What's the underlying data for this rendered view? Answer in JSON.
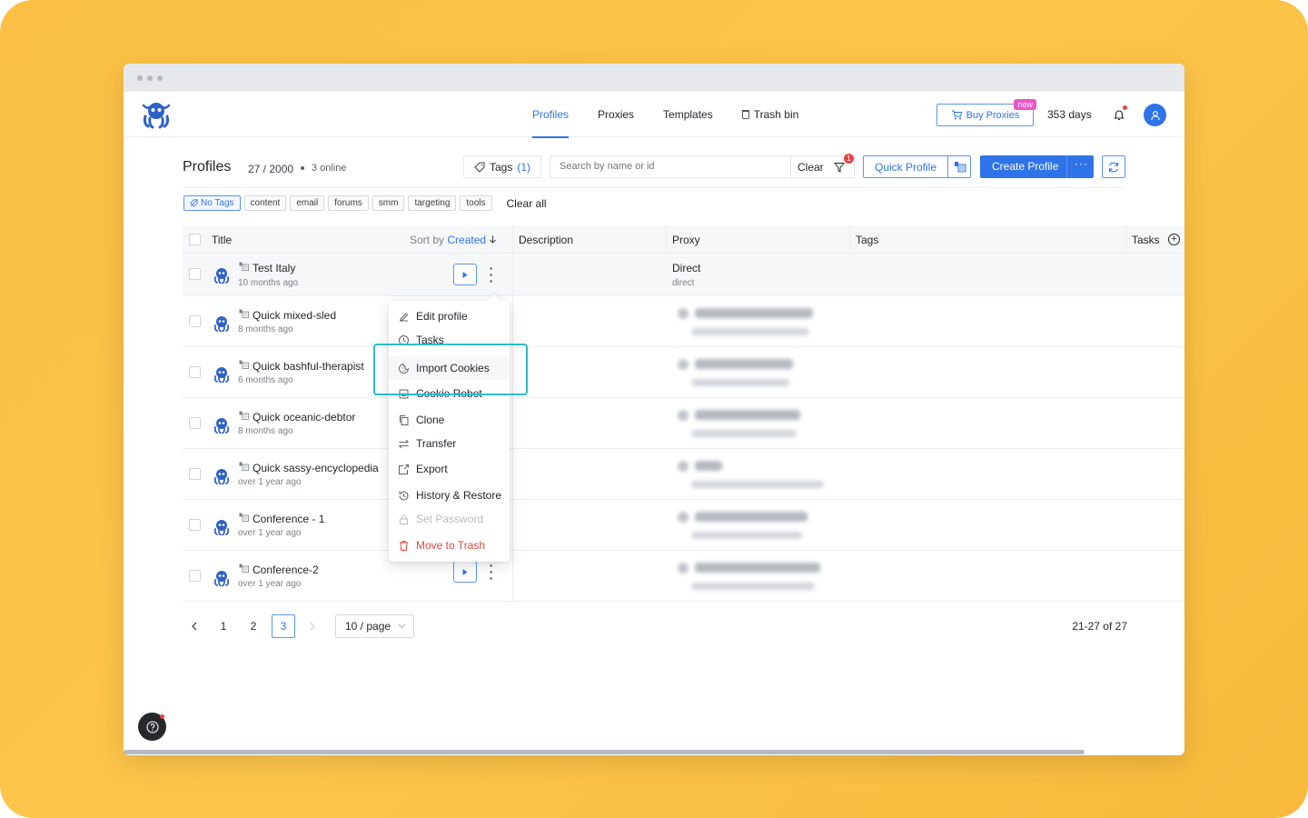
{
  "nav": {
    "tabs": [
      "Profiles",
      "Proxies",
      "Templates",
      "Trash bin"
    ],
    "buy_proxies": "Buy Proxies",
    "new_badge": "new",
    "days": "353 days"
  },
  "header": {
    "title": "Profiles",
    "count": "27 / 2000",
    "online": "3 online",
    "tags_label": "Tags",
    "tags_count": "(1)",
    "search_placeholder": "Search by name or id",
    "clear": "Clear",
    "filter_badge": "1",
    "quick_profile": "Quick Profile",
    "create_profile": "Create Profile",
    "create_more": "···"
  },
  "tag_filters": {
    "chips": [
      "No Tags",
      "content",
      "email",
      "forums",
      "smm",
      "targeting",
      "tools"
    ],
    "clear_all": "Clear all"
  },
  "table": {
    "columns": {
      "title": "Title",
      "sort_by": "Sort by",
      "sort_value": "Created",
      "description": "Description",
      "proxy": "Proxy",
      "tags": "Tags",
      "tasks": "Tasks"
    },
    "rows": [
      {
        "name": "Test Italy",
        "time": "10 months ago",
        "proxy_main": "Direct",
        "proxy_sub": "direct"
      },
      {
        "name": "Quick mixed-sled",
        "time": "8 months ago"
      },
      {
        "name": "Quick bashful-therapist",
        "time": "6 months ago"
      },
      {
        "name": "Quick oceanic-debtor",
        "time": "8 months ago"
      },
      {
        "name": "Quick sassy-encyclopedia",
        "time": "over 1 year ago"
      },
      {
        "name": "Conference - 1",
        "time": "over 1 year ago"
      },
      {
        "name": "Conference-2",
        "time": "over 1 year ago"
      }
    ]
  },
  "context_menu": {
    "items": [
      "Edit profile",
      "Tasks",
      "Import Cookies",
      "Cookie Robot",
      "Clone",
      "Transfer",
      "Export",
      "History & Restore",
      "Set Password",
      "Move to Trash"
    ]
  },
  "pagination": {
    "pages": [
      "1",
      "2",
      "3"
    ],
    "current": "3",
    "page_size": "10 / page",
    "range": "21-27 of 27"
  },
  "colors": {
    "accent": "#2f73e8",
    "danger": "#e2463b",
    "highlight": "#2bbcc9",
    "background": "#fcc549"
  }
}
